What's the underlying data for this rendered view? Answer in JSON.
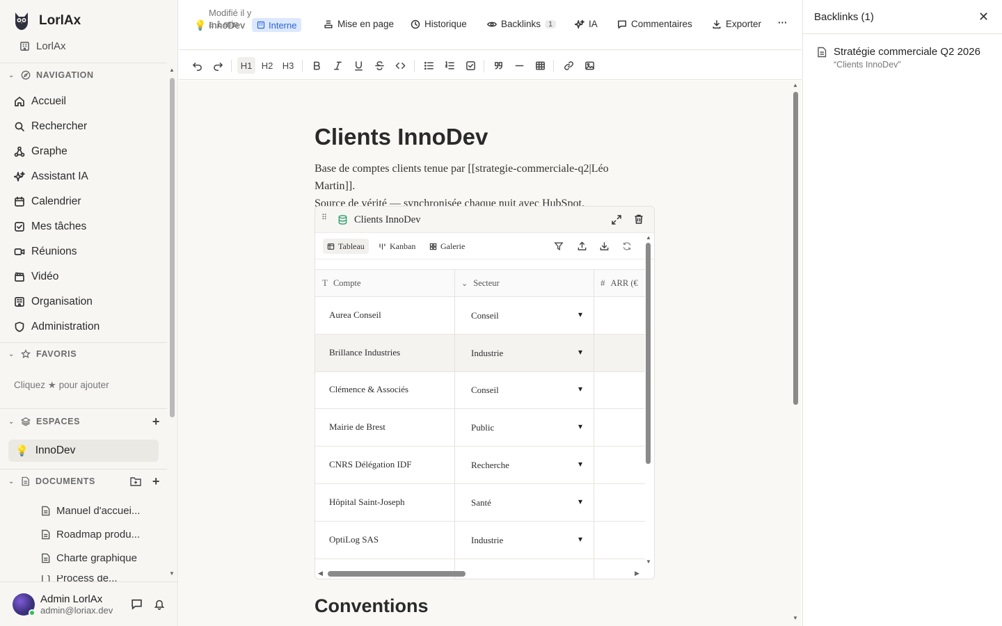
{
  "sidebar": {
    "brand": "LorlAx",
    "org": "LorlAx",
    "navigation_label": "NAVIGATION",
    "nav": [
      {
        "label": "Accueil",
        "icon": "home-icon"
      },
      {
        "label": "Rechercher",
        "icon": "search-icon"
      },
      {
        "label": "Graphe",
        "icon": "graph-icon"
      },
      {
        "label": "Assistant IA",
        "icon": "sparkle-icon"
      },
      {
        "label": "Calendrier",
        "icon": "calendar-icon"
      },
      {
        "label": "Mes tâches",
        "icon": "checkbox-icon"
      },
      {
        "label": "Réunions",
        "icon": "video-camera-icon"
      },
      {
        "label": "Vidéo",
        "icon": "clapperboard-icon"
      },
      {
        "label": "Organisation",
        "icon": "building-icon"
      },
      {
        "label": "Administration",
        "icon": "shield-icon"
      }
    ],
    "favoris_label": "FAVORIS",
    "favoris_hint": "Cliquez ★ pour ajouter",
    "espaces_label": "ESPACES",
    "space": "InnoDev",
    "documents_label": "DOCUMENTS",
    "documents": [
      "Manuel d'accuei...",
      "Roadmap produ...",
      "Charte graphique",
      "Process de..."
    ],
    "user": {
      "name": "Admin LorlAx",
      "email": "admin@loriax.dev"
    }
  },
  "topbar": {
    "modified": "Modifié il y a 1 min",
    "space": "InnoDev",
    "visibility": "Interne",
    "layout": "Mise en page",
    "history": "Historique",
    "backlinks": "Backlinks",
    "backlinks_count": "1",
    "ai": "IA",
    "comments": "Commentaires",
    "export": "Exporter",
    "more": "···"
  },
  "formatbar": {
    "h1": "H1",
    "h2": "H2",
    "h3": "H3"
  },
  "doc": {
    "title": "Clients InnoDev",
    "paragraph_1": "Base de comptes clients tenue par [[strategie-commerciale-q2|Léo Martin]].",
    "paragraph_2": "Source de vérité — synchronisée chaque nuit avec HubSpot.",
    "next_heading": "Conventions"
  },
  "database": {
    "title": "Clients InnoDev",
    "views": [
      "Tableau",
      "Kanban",
      "Galerie"
    ],
    "columns": [
      "Compte",
      "Secteur",
      "ARR (€"
    ],
    "rows": [
      {
        "compte": "Aurea Conseil",
        "secteur": "Conseil"
      },
      {
        "compte": "Brillance Industries",
        "secteur": "Industrie"
      },
      {
        "compte": "Clémence & Associés",
        "secteur": "Conseil"
      },
      {
        "compte": "Mairie de Brest",
        "secteur": "Public"
      },
      {
        "compte": "CNRS Délégation IDF",
        "secteur": "Recherche"
      },
      {
        "compte": "Hôpital Saint-Joseph",
        "secteur": "Santé"
      },
      {
        "compte": "OptiLog SAS",
        "secteur": "Industrie"
      }
    ]
  },
  "right_panel": {
    "title": "Backlinks (1)",
    "item_title": "Stratégie commerciale Q2 2026",
    "item_snippet": "“Clients InnoDev”"
  },
  "colors": {
    "accent": "#2a63d6",
    "badge_bg": "#dbe8ff",
    "db_icon": "#2ea36b",
    "status_online": "#2ec05c"
  }
}
